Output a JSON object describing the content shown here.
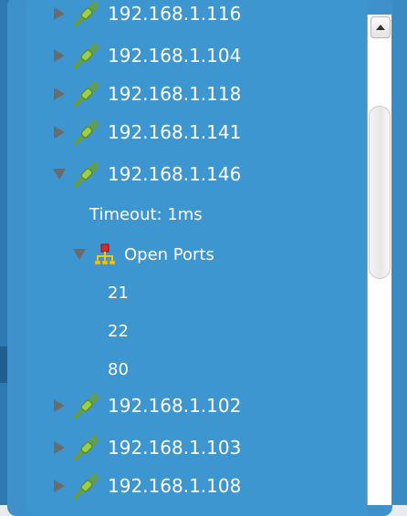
{
  "tree": {
    "partial_top_label": "192.168.1.116",
    "items": [
      {
        "label": "192.168.1.104",
        "expanded": false
      },
      {
        "label": "192.168.1.118",
        "expanded": false
      },
      {
        "label": "192.168.1.141",
        "expanded": false
      },
      {
        "label": "192.168.1.146",
        "expanded": true,
        "timeout_label": "Timeout: 1ms",
        "open_ports_label": "Open Ports",
        "ports": [
          "21",
          "22",
          "80"
        ]
      },
      {
        "label": "192.168.1.102",
        "expanded": false
      },
      {
        "label": "192.168.1.103",
        "expanded": false
      },
      {
        "label": "192.168.1.108",
        "expanded": false
      }
    ]
  },
  "icons": {
    "host": "plug-icon",
    "ports": "network-icon",
    "collapsed": "triangle-right-icon",
    "expanded": "triangle-down-icon"
  },
  "colors": {
    "panel": "#3e96d1",
    "text": "#ffffff",
    "plug_green": "#8dc63f"
  }
}
